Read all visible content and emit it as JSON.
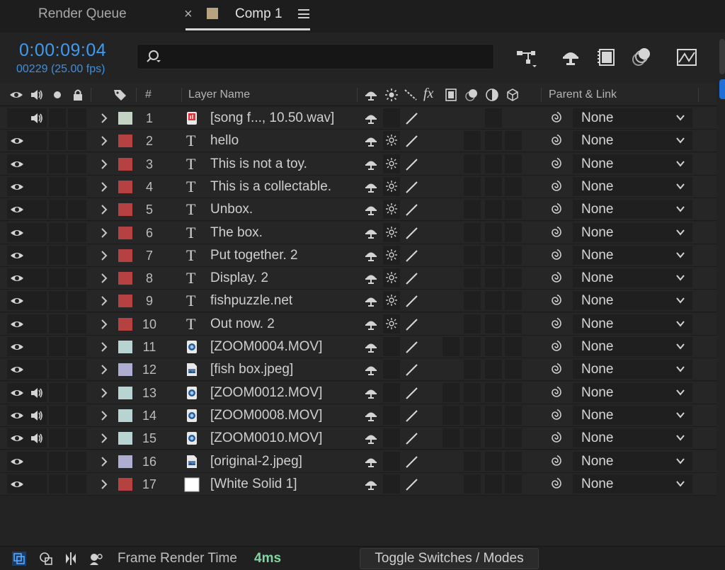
{
  "tabs": {
    "render_queue": "Render Queue",
    "close_glyph": "×",
    "comp": "Comp 1",
    "comp_color": "#b6a382"
  },
  "timecode": "0:00:09:04",
  "frame_info": "00229 (25.00 fps)",
  "search": {
    "placeholder": "",
    "icon": "search-icon"
  },
  "columns": {
    "number": "#",
    "layer_name": "Layer Name",
    "parent": "Parent & Link"
  },
  "layers": [
    {
      "n": "1",
      "name": "[song f..., 10.50.wav]",
      "type": "audio",
      "label": "#c3d3c4",
      "video": false,
      "audio": true,
      "quality": false,
      "parent": "None"
    },
    {
      "n": "2",
      "name": "hello",
      "type": "text",
      "label": "#b54141",
      "video": true,
      "audio": false,
      "quality": true,
      "parent": "None"
    },
    {
      "n": "3",
      "name": "This is not a toy.",
      "type": "text",
      "label": "#b54141",
      "video": true,
      "audio": false,
      "quality": true,
      "parent": "None"
    },
    {
      "n": "4",
      "name": "This is a collectable.",
      "type": "text",
      "label": "#b54141",
      "video": true,
      "audio": false,
      "quality": true,
      "parent": "None"
    },
    {
      "n": "5",
      "name": "Unbox.",
      "type": "text",
      "label": "#b54141",
      "video": true,
      "audio": false,
      "quality": true,
      "parent": "None"
    },
    {
      "n": "6",
      "name": "The box.",
      "type": "text",
      "label": "#b54141",
      "video": true,
      "audio": false,
      "quality": true,
      "parent": "None"
    },
    {
      "n": "7",
      "name": "Put together. 2",
      "type": "text",
      "label": "#b54141",
      "video": true,
      "audio": false,
      "quality": true,
      "parent": "None"
    },
    {
      "n": "8",
      "name": "Display. 2",
      "type": "text",
      "label": "#b54141",
      "video": true,
      "audio": false,
      "quality": true,
      "parent": "None"
    },
    {
      "n": "9",
      "name": "fishpuzzle.net",
      "type": "text",
      "label": "#b54141",
      "video": true,
      "audio": false,
      "quality": true,
      "parent": "None"
    },
    {
      "n": "10",
      "name": "Out now. 2",
      "type": "text",
      "label": "#b54141",
      "video": true,
      "audio": false,
      "quality": true,
      "parent": "None"
    },
    {
      "n": "11",
      "name": "[ZOOM0004.MOV]",
      "type": "video",
      "label": "#b9d3d3",
      "video": true,
      "audio": false,
      "quality": false,
      "parent": "None"
    },
    {
      "n": "12",
      "name": "[fish box.jpeg]",
      "type": "image",
      "label": "#aeaed0",
      "video": true,
      "audio": false,
      "quality": false,
      "parent": "None"
    },
    {
      "n": "13",
      "name": "[ZOOM0012.MOV]",
      "type": "video",
      "label": "#b9d3d3",
      "video": true,
      "audio": true,
      "quality": false,
      "parent": "None"
    },
    {
      "n": "14",
      "name": "[ZOOM0008.MOV]",
      "type": "video",
      "label": "#b9d3d3",
      "video": true,
      "audio": true,
      "quality": false,
      "parent": "None"
    },
    {
      "n": "15",
      "name": "[ZOOM0010.MOV]",
      "type": "video",
      "label": "#b9d3d3",
      "video": true,
      "audio": true,
      "quality": false,
      "parent": "None"
    },
    {
      "n": "16",
      "name": "[original-2.jpeg]",
      "type": "image",
      "label": "#aeaed0",
      "video": true,
      "audio": false,
      "quality": false,
      "parent": "None"
    },
    {
      "n": "17",
      "name": "[White Solid 1]",
      "type": "solid",
      "label": "#b54141",
      "video": true,
      "audio": false,
      "quality": false,
      "parent": "None"
    }
  ],
  "footer": {
    "render_label": "Frame Render Time",
    "render_value": "4ms",
    "toggle": "Toggle Switches / Modes"
  },
  "colors": {
    "accent_blue": "#3f9bf0",
    "render_time": "#7fd6a0"
  }
}
